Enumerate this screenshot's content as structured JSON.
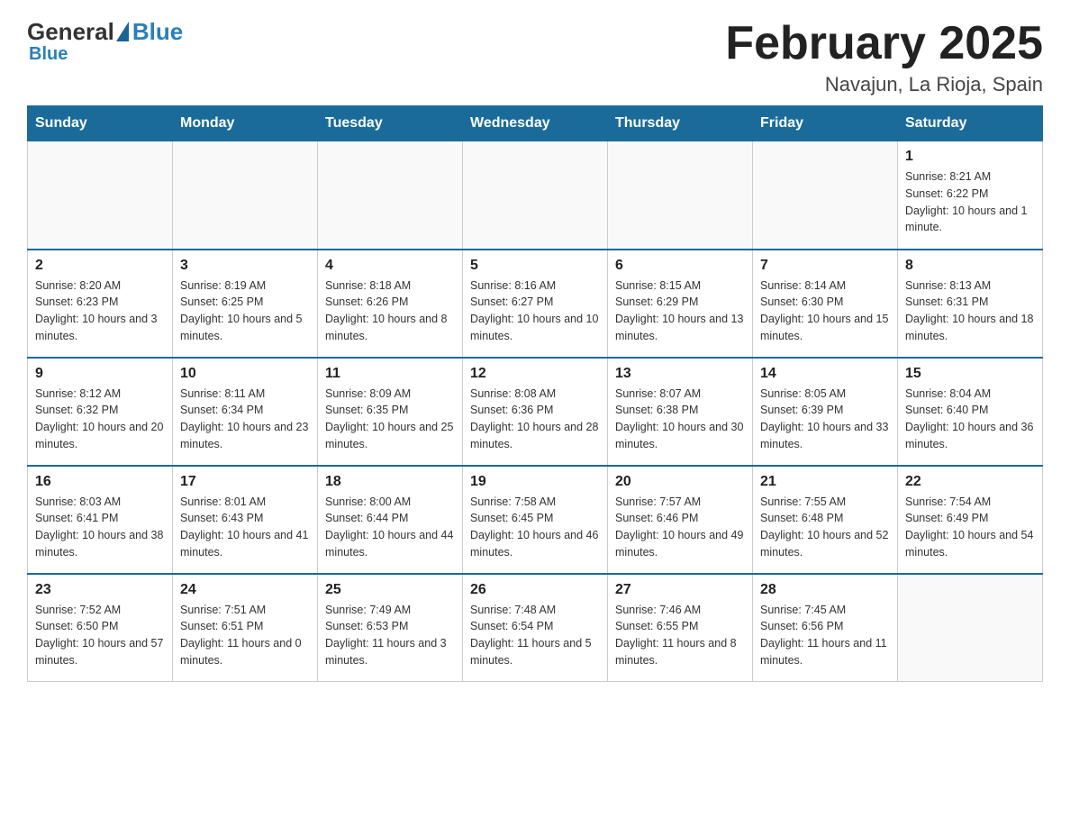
{
  "logo": {
    "general": "General",
    "blue": "Blue"
  },
  "title": "February 2025",
  "subtitle": "Navajun, La Rioja, Spain",
  "days_of_week": [
    "Sunday",
    "Monday",
    "Tuesday",
    "Wednesday",
    "Thursday",
    "Friday",
    "Saturday"
  ],
  "weeks": [
    [
      {
        "day": "",
        "sunrise": "",
        "sunset": "",
        "daylight": ""
      },
      {
        "day": "",
        "sunrise": "",
        "sunset": "",
        "daylight": ""
      },
      {
        "day": "",
        "sunrise": "",
        "sunset": "",
        "daylight": ""
      },
      {
        "day": "",
        "sunrise": "",
        "sunset": "",
        "daylight": ""
      },
      {
        "day": "",
        "sunrise": "",
        "sunset": "",
        "daylight": ""
      },
      {
        "day": "",
        "sunrise": "",
        "sunset": "",
        "daylight": ""
      },
      {
        "day": "1",
        "sunrise": "Sunrise: 8:21 AM",
        "sunset": "Sunset: 6:22 PM",
        "daylight": "Daylight: 10 hours and 1 minute."
      }
    ],
    [
      {
        "day": "2",
        "sunrise": "Sunrise: 8:20 AM",
        "sunset": "Sunset: 6:23 PM",
        "daylight": "Daylight: 10 hours and 3 minutes."
      },
      {
        "day": "3",
        "sunrise": "Sunrise: 8:19 AM",
        "sunset": "Sunset: 6:25 PM",
        "daylight": "Daylight: 10 hours and 5 minutes."
      },
      {
        "day": "4",
        "sunrise": "Sunrise: 8:18 AM",
        "sunset": "Sunset: 6:26 PM",
        "daylight": "Daylight: 10 hours and 8 minutes."
      },
      {
        "day": "5",
        "sunrise": "Sunrise: 8:16 AM",
        "sunset": "Sunset: 6:27 PM",
        "daylight": "Daylight: 10 hours and 10 minutes."
      },
      {
        "day": "6",
        "sunrise": "Sunrise: 8:15 AM",
        "sunset": "Sunset: 6:29 PM",
        "daylight": "Daylight: 10 hours and 13 minutes."
      },
      {
        "day": "7",
        "sunrise": "Sunrise: 8:14 AM",
        "sunset": "Sunset: 6:30 PM",
        "daylight": "Daylight: 10 hours and 15 minutes."
      },
      {
        "day": "8",
        "sunrise": "Sunrise: 8:13 AM",
        "sunset": "Sunset: 6:31 PM",
        "daylight": "Daylight: 10 hours and 18 minutes."
      }
    ],
    [
      {
        "day": "9",
        "sunrise": "Sunrise: 8:12 AM",
        "sunset": "Sunset: 6:32 PM",
        "daylight": "Daylight: 10 hours and 20 minutes."
      },
      {
        "day": "10",
        "sunrise": "Sunrise: 8:11 AM",
        "sunset": "Sunset: 6:34 PM",
        "daylight": "Daylight: 10 hours and 23 minutes."
      },
      {
        "day": "11",
        "sunrise": "Sunrise: 8:09 AM",
        "sunset": "Sunset: 6:35 PM",
        "daylight": "Daylight: 10 hours and 25 minutes."
      },
      {
        "day": "12",
        "sunrise": "Sunrise: 8:08 AM",
        "sunset": "Sunset: 6:36 PM",
        "daylight": "Daylight: 10 hours and 28 minutes."
      },
      {
        "day": "13",
        "sunrise": "Sunrise: 8:07 AM",
        "sunset": "Sunset: 6:38 PM",
        "daylight": "Daylight: 10 hours and 30 minutes."
      },
      {
        "day": "14",
        "sunrise": "Sunrise: 8:05 AM",
        "sunset": "Sunset: 6:39 PM",
        "daylight": "Daylight: 10 hours and 33 minutes."
      },
      {
        "day": "15",
        "sunrise": "Sunrise: 8:04 AM",
        "sunset": "Sunset: 6:40 PM",
        "daylight": "Daylight: 10 hours and 36 minutes."
      }
    ],
    [
      {
        "day": "16",
        "sunrise": "Sunrise: 8:03 AM",
        "sunset": "Sunset: 6:41 PM",
        "daylight": "Daylight: 10 hours and 38 minutes."
      },
      {
        "day": "17",
        "sunrise": "Sunrise: 8:01 AM",
        "sunset": "Sunset: 6:43 PM",
        "daylight": "Daylight: 10 hours and 41 minutes."
      },
      {
        "day": "18",
        "sunrise": "Sunrise: 8:00 AM",
        "sunset": "Sunset: 6:44 PM",
        "daylight": "Daylight: 10 hours and 44 minutes."
      },
      {
        "day": "19",
        "sunrise": "Sunrise: 7:58 AM",
        "sunset": "Sunset: 6:45 PM",
        "daylight": "Daylight: 10 hours and 46 minutes."
      },
      {
        "day": "20",
        "sunrise": "Sunrise: 7:57 AM",
        "sunset": "Sunset: 6:46 PM",
        "daylight": "Daylight: 10 hours and 49 minutes."
      },
      {
        "day": "21",
        "sunrise": "Sunrise: 7:55 AM",
        "sunset": "Sunset: 6:48 PM",
        "daylight": "Daylight: 10 hours and 52 minutes."
      },
      {
        "day": "22",
        "sunrise": "Sunrise: 7:54 AM",
        "sunset": "Sunset: 6:49 PM",
        "daylight": "Daylight: 10 hours and 54 minutes."
      }
    ],
    [
      {
        "day": "23",
        "sunrise": "Sunrise: 7:52 AM",
        "sunset": "Sunset: 6:50 PM",
        "daylight": "Daylight: 10 hours and 57 minutes."
      },
      {
        "day": "24",
        "sunrise": "Sunrise: 7:51 AM",
        "sunset": "Sunset: 6:51 PM",
        "daylight": "Daylight: 11 hours and 0 minutes."
      },
      {
        "day": "25",
        "sunrise": "Sunrise: 7:49 AM",
        "sunset": "Sunset: 6:53 PM",
        "daylight": "Daylight: 11 hours and 3 minutes."
      },
      {
        "day": "26",
        "sunrise": "Sunrise: 7:48 AM",
        "sunset": "Sunset: 6:54 PM",
        "daylight": "Daylight: 11 hours and 5 minutes."
      },
      {
        "day": "27",
        "sunrise": "Sunrise: 7:46 AM",
        "sunset": "Sunset: 6:55 PM",
        "daylight": "Daylight: 11 hours and 8 minutes."
      },
      {
        "day": "28",
        "sunrise": "Sunrise: 7:45 AM",
        "sunset": "Sunset: 6:56 PM",
        "daylight": "Daylight: 11 hours and 11 minutes."
      },
      {
        "day": "",
        "sunrise": "",
        "sunset": "",
        "daylight": ""
      }
    ]
  ]
}
